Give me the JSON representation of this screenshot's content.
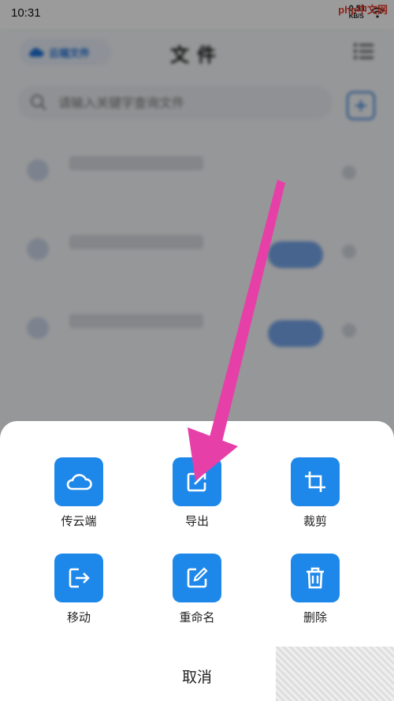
{
  "status_bar": {
    "time": "10:31",
    "speed": "0.51",
    "speed_unit": "KB/S",
    "logo": "php中文网"
  },
  "header": {
    "cloud_button_label": "云端文件",
    "title": "文件"
  },
  "search": {
    "placeholder": "请输入关键字查询文件"
  },
  "sheet": {
    "actions": [
      {
        "label": "传云端",
        "icon": "cloud-icon"
      },
      {
        "label": "导出",
        "icon": "export-icon"
      },
      {
        "label": "裁剪",
        "icon": "crop-icon"
      },
      {
        "label": "移动",
        "icon": "move-icon"
      },
      {
        "label": "重命名",
        "icon": "rename-icon"
      },
      {
        "label": "删除",
        "icon": "trash-icon"
      }
    ],
    "cancel_label": "取消"
  },
  "colors": {
    "accent": "#1e88ea",
    "annotation_arrow": "#e63fa8"
  }
}
